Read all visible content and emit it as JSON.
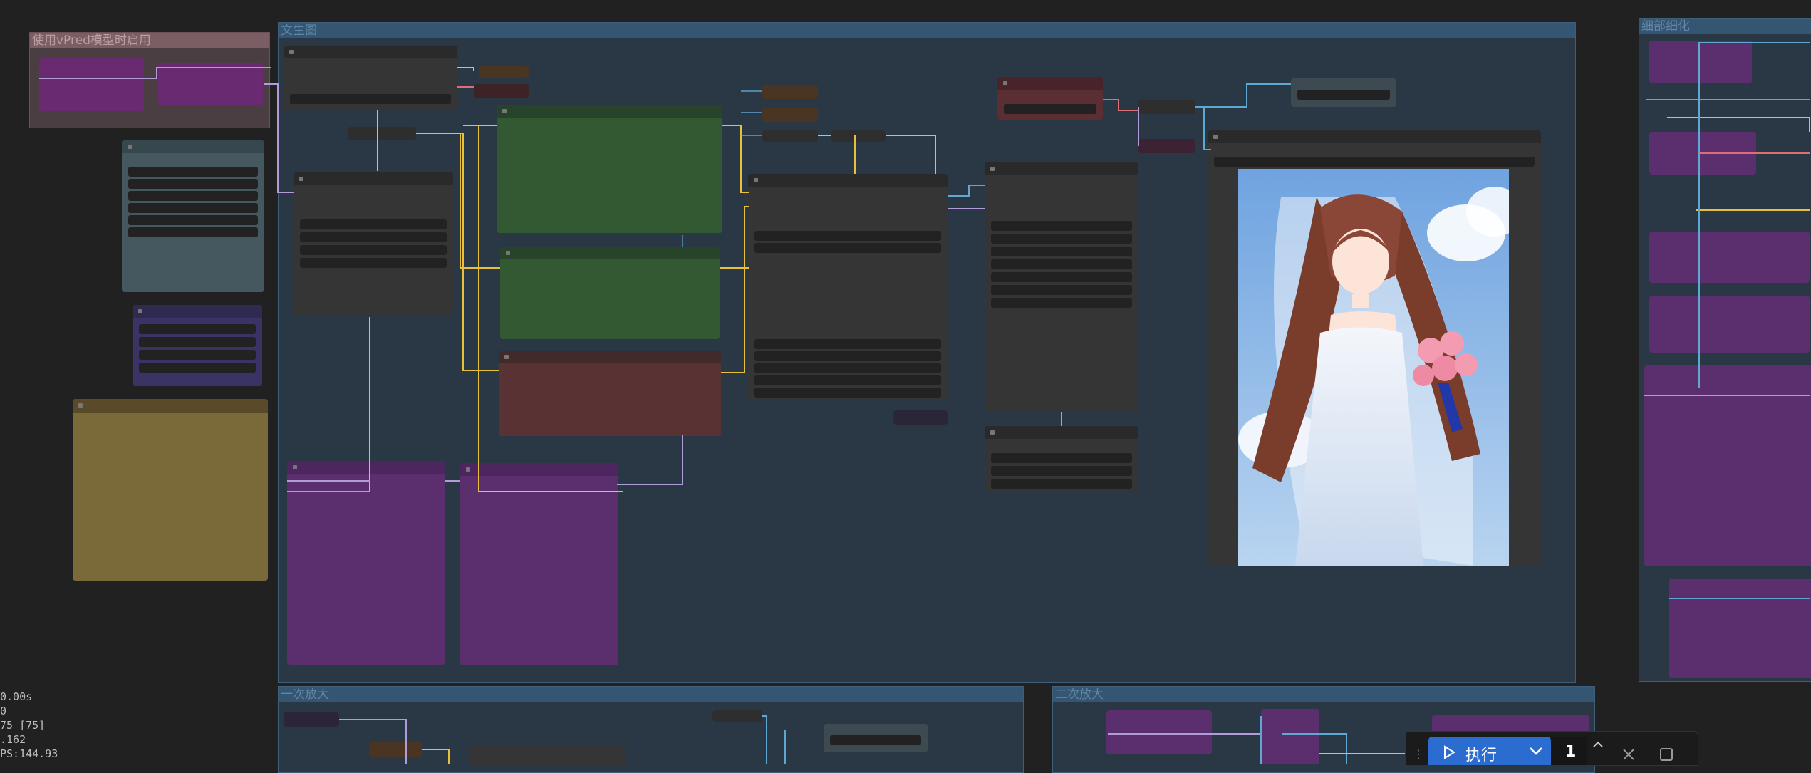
{
  "groups": {
    "vpred": "使用vPred模型时启用",
    "txt2img": "文生图",
    "upscale1": "一次放大",
    "upscale2": "二次放大",
    "detail": "细部细化"
  },
  "stats_lines": [
    "0.00s",
    "0",
    "75 [75]",
    ".162",
    "PS:144.93"
  ],
  "toolbar": {
    "run_label": "执行",
    "batch_count": "1"
  },
  "icons": [
    "play-icon",
    "chevron-down-icon",
    "chevron-up-icon",
    "close-icon",
    "stop-icon",
    "drag-handle-icon"
  ],
  "colors": {
    "canvas": "#212121",
    "group_header": "#355672",
    "run_button": "#2a6cd0",
    "wire_yellow": "#e8c03a",
    "wire_purple": "#b19cd9",
    "wire_blue": "#5fa8d3",
    "wire_red": "#e06c75"
  },
  "preview": {
    "subject": "anime girl in white wedding dress holding pink rose bouquet"
  }
}
